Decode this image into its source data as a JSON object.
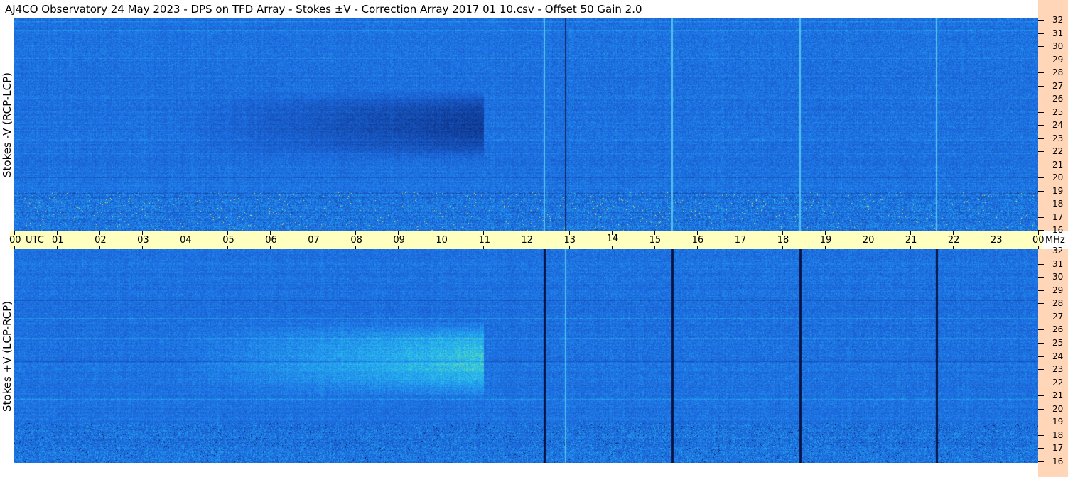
{
  "title": "AJ4CO Observatory  24 May 2023  -  DPS on TFD Array  -  Stokes ±V  -  Correction Array 2017 01 10.csv  -  Offset 50  Gain 2.0",
  "colors": {
    "background": "#ffffff",
    "axis_band": "#ffffc0",
    "freq_strip": "#ffd6b8",
    "spectrogram_base": "#1e6fe6"
  },
  "chart_data": [
    {
      "type": "heatmap",
      "ylabel": "Stokes -V  (RCP-LCP)",
      "y_unit": "MHz",
      "yticks": [
        "32",
        "31",
        "30",
        "29",
        "28",
        "27",
        "26",
        "25",
        "24",
        "23",
        "22",
        "21",
        "20",
        "19",
        "18",
        "17",
        "16"
      ],
      "ylim": [
        16,
        32
      ],
      "xlim": [
        0,
        24
      ],
      "x_unit": "UTC",
      "xticks": [
        "00",
        "01",
        "02",
        "03",
        "04",
        "05",
        "06",
        "07",
        "08",
        "09",
        "10",
        "11",
        "12",
        "13",
        "14",
        "15",
        "16",
        "17",
        "18",
        "19",
        "20",
        "21",
        "22",
        "23",
        "00"
      ],
      "features": {
        "vertical_bright_lines_utc": [
          12.4,
          15.4,
          18.4,
          21.6
        ],
        "vertical_dark_lines_utc": [
          12.9
        ],
        "dark_region_utc": [
          7.0,
          11.0
        ],
        "dark_region_mhz": [
          23.5,
          24.5
        ],
        "busy_band_mhz": [
          16.0,
          19.0
        ]
      }
    },
    {
      "type": "heatmap",
      "ylabel": "Stokes +V  (LCP-RCP)",
      "y_unit": "MHz",
      "yticks": [
        "32",
        "31",
        "30",
        "29",
        "28",
        "27",
        "26",
        "25",
        "24",
        "23",
        "22",
        "21",
        "20",
        "19",
        "18",
        "17",
        "16"
      ],
      "ylim": [
        16,
        32
      ],
      "xlim": [
        0,
        24
      ],
      "x_unit": "UTC",
      "xticks": [
        "00",
        "01",
        "02",
        "03",
        "04",
        "05",
        "06",
        "07",
        "08",
        "09",
        "10",
        "11",
        "12",
        "13",
        "14",
        "15",
        "16",
        "17",
        "18",
        "19",
        "20",
        "21",
        "22",
        "23",
        "00"
      ],
      "features": {
        "vertical_dark_lines_utc": [
          12.4,
          15.4,
          18.4,
          21.6
        ],
        "vertical_bright_lines_utc": [
          12.9
        ],
        "bright_region_utc": [
          7.0,
          11.0
        ],
        "bright_region_mhz": [
          23.0,
          24.5
        ],
        "busy_band_mhz": [
          16.0,
          19.0
        ]
      }
    }
  ]
}
